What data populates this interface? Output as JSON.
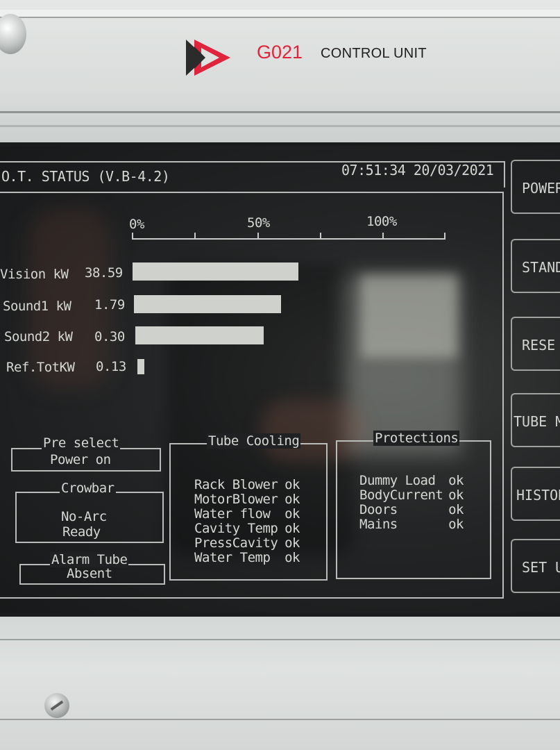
{
  "header": {
    "code": "G021",
    "title": "CONTROL UNIT"
  },
  "screen": {
    "title": "O.T. STATUS (V.B-4.2)",
    "clock": "07:51:34 20/03/2021",
    "scale": [
      "0%",
      "50%",
      "100%"
    ],
    "meters": [
      {
        "label": "Vision kW",
        "value": "38.59",
        "fill": 0.53
      },
      {
        "label": "Sound1 kW",
        "value": "1.79",
        "fill": 0.47
      },
      {
        "label": "Sound2 kW",
        "value": "0.30",
        "fill": 0.41
      },
      {
        "label": "Ref.TotKW",
        "value": "0.13",
        "fill": 0.02
      }
    ],
    "preselect": {
      "title": "Pre select",
      "value": "Power on"
    },
    "crowbar": {
      "title": "Crowbar",
      "line1": "No-Arc",
      "line2": "Ready"
    },
    "alarm_tube": {
      "title": "Alarm Tube",
      "value": "Absent"
    },
    "tube_cooling": {
      "title": "Tube Cooling",
      "items": [
        {
          "name": "Rack Blower",
          "status": "ok"
        },
        {
          "name": "MotorBlower",
          "status": "ok"
        },
        {
          "name": "Water flow",
          "status": "ok"
        },
        {
          "name": "Cavity Temp",
          "status": "ok"
        },
        {
          "name": "PressCavity",
          "status": "ok"
        },
        {
          "name": "Water  Temp",
          "status": "ok"
        }
      ]
    },
    "protections": {
      "title": "Protections",
      "items": [
        {
          "name": "Dummy Load",
          "status": "ok"
        },
        {
          "name": "BodyCurrent",
          "status": "ok"
        },
        {
          "name": "Doors",
          "status": "ok"
        },
        {
          "name": "Mains",
          "status": "ok"
        }
      ]
    }
  },
  "side_buttons": [
    "POWER",
    "STAND",
    "RESE",
    "TUBE ME",
    "HISTOR",
    "SET U"
  ],
  "colors": {
    "brand_red": "#e0243b",
    "screen_text": "#d6d8d4",
    "screen_bg": "#232526"
  }
}
